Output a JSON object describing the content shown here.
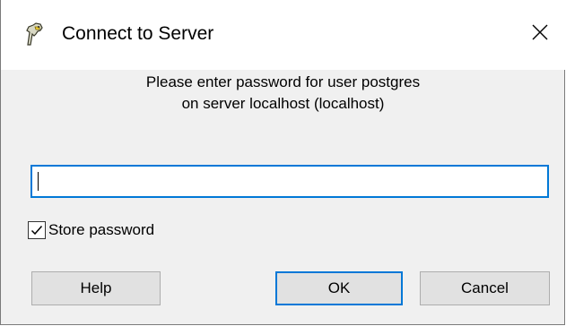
{
  "window": {
    "title": "Connect to Server",
    "app_icon": "postgres-elephant-icon",
    "close_icon": "close-icon"
  },
  "prompt": {
    "line1": "Please enter password for user postgres",
    "line2": "on server localhost (localhost)"
  },
  "password": {
    "value": "",
    "placeholder": ""
  },
  "store_password": {
    "label": "Store password",
    "checked": true
  },
  "buttons": {
    "help": "Help",
    "ok": "OK",
    "cancel": "Cancel"
  },
  "colors": {
    "accent": "#0078d7",
    "dialog_background": "#f0f0f0",
    "title_background": "#ffffff",
    "button_background": "#e1e1e1"
  }
}
